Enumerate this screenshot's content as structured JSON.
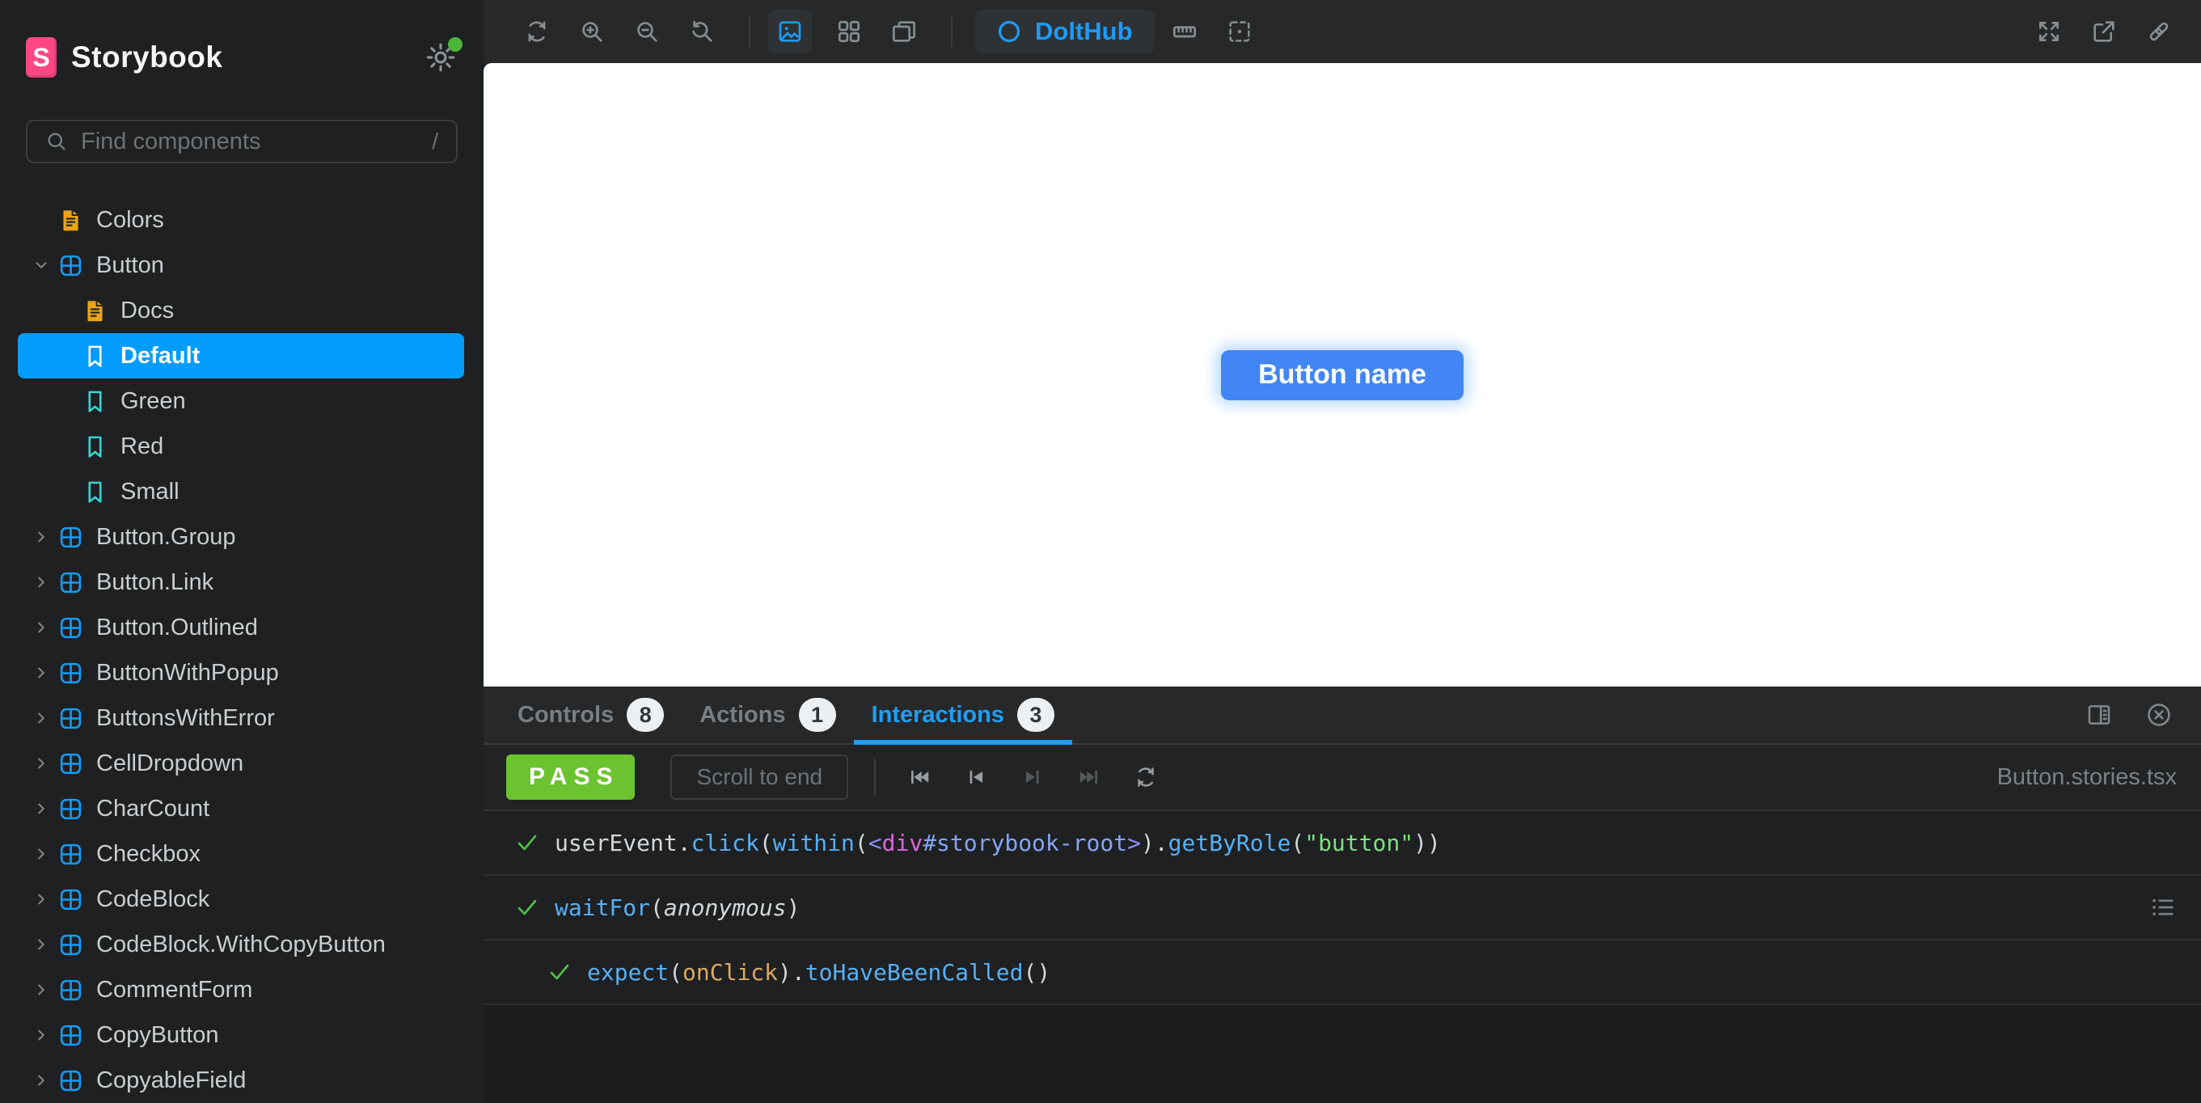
{
  "colors": {
    "accent": "#1EA7FD",
    "selection": "#029CFD",
    "brand_pink": "#FF4785",
    "story_teal": "#37D5D3",
    "doc_amber": "#EBA31B",
    "pass_green": "#6CC330",
    "canvas_button_blue": "#4285F4"
  },
  "sidebar": {
    "brand": {
      "logo_letter": "S",
      "title": "Storybook"
    },
    "search": {
      "placeholder": "Find components",
      "shortcut": "/"
    },
    "tree": [
      {
        "label": "Colors",
        "type": "doc",
        "depth": 0
      },
      {
        "label": "Button",
        "type": "component",
        "depth": 0,
        "expanded": true
      },
      {
        "label": "Docs",
        "type": "doc",
        "depth": 1
      },
      {
        "label": "Default",
        "type": "story",
        "depth": 1,
        "selected": true
      },
      {
        "label": "Green",
        "type": "story",
        "depth": 1
      },
      {
        "label": "Red",
        "type": "story",
        "depth": 1
      },
      {
        "label": "Small",
        "type": "story",
        "depth": 1
      },
      {
        "label": "Button.Group",
        "type": "component",
        "depth": 0
      },
      {
        "label": "Button.Link",
        "type": "component",
        "depth": 0
      },
      {
        "label": "Button.Outlined",
        "type": "component",
        "depth": 0
      },
      {
        "label": "ButtonWithPopup",
        "type": "component",
        "depth": 0
      },
      {
        "label": "ButtonsWithError",
        "type": "component",
        "depth": 0
      },
      {
        "label": "CellDropdown",
        "type": "component",
        "depth": 0
      },
      {
        "label": "CharCount",
        "type": "component",
        "depth": 0
      },
      {
        "label": "Checkbox",
        "type": "component",
        "depth": 0
      },
      {
        "label": "CodeBlock",
        "type": "component",
        "depth": 0
      },
      {
        "label": "CodeBlock.WithCopyButton",
        "type": "component",
        "depth": 0
      },
      {
        "label": "CommentForm",
        "type": "component",
        "depth": 0
      },
      {
        "label": "CopyButton",
        "type": "component",
        "depth": 0
      },
      {
        "label": "CopyableField",
        "type": "component",
        "depth": 0
      }
    ]
  },
  "toolbar": {
    "left_icons": [
      "remount",
      "zoom-in",
      "zoom-out",
      "zoom-reset",
      "divider",
      "backgrounds",
      "grid",
      "viewports",
      "divider",
      "dolthub",
      "measure",
      "outline"
    ],
    "dolthub_label": "DoltHub",
    "right_icons": [
      "fullscreen",
      "open-new-tab",
      "copy-link"
    ]
  },
  "canvas": {
    "button_label": "Button name"
  },
  "panel": {
    "tabs": [
      {
        "label": "Controls",
        "count": "8",
        "active": false
      },
      {
        "label": "Actions",
        "count": "1",
        "active": false
      },
      {
        "label": "Interactions",
        "count": "3",
        "active": true
      }
    ],
    "right_icons": [
      "panel-position",
      "close-panel"
    ],
    "toolbar": {
      "status": "PASS",
      "scroll_button": "Scroll to end",
      "playback": [
        "jump-to-start",
        "step-back",
        "step-forward",
        "jump-to-end",
        "rerun"
      ],
      "playback_disabled": [
        "step-forward",
        "jump-to-end"
      ],
      "file": "Button.stories.tsx"
    },
    "interactions": [
      {
        "depth": 0,
        "status": "pass",
        "segments": [
          [
            "userEvent.",
            "base"
          ],
          [
            "click",
            "method"
          ],
          [
            "(",
            "base"
          ],
          [
            "within",
            "method"
          ],
          [
            "(",
            "base"
          ],
          [
            "<",
            "tag"
          ],
          [
            "div",
            "elem"
          ],
          [
            "#storybook-root",
            "id"
          ],
          [
            ">",
            "tag"
          ],
          [
            ").",
            "base"
          ],
          [
            "getByRole",
            "method"
          ],
          [
            "(",
            "base"
          ],
          [
            "\"button\"",
            "string"
          ],
          [
            "))",
            "base"
          ]
        ]
      },
      {
        "depth": 0,
        "status": "pass",
        "trailing_icon": "step-list",
        "segments": [
          [
            "waitFor",
            "method"
          ],
          [
            "(",
            "base"
          ],
          [
            "anonymous",
            "italic"
          ],
          [
            ")",
            "base"
          ]
        ]
      },
      {
        "depth": 1,
        "status": "pass",
        "segments": [
          [
            "expect",
            "method"
          ],
          [
            "(",
            "base"
          ],
          [
            "onClick",
            "ident"
          ],
          [
            ").",
            "base"
          ],
          [
            "toHaveBeenCalled",
            "method"
          ],
          [
            "()",
            "base"
          ]
        ]
      }
    ]
  }
}
